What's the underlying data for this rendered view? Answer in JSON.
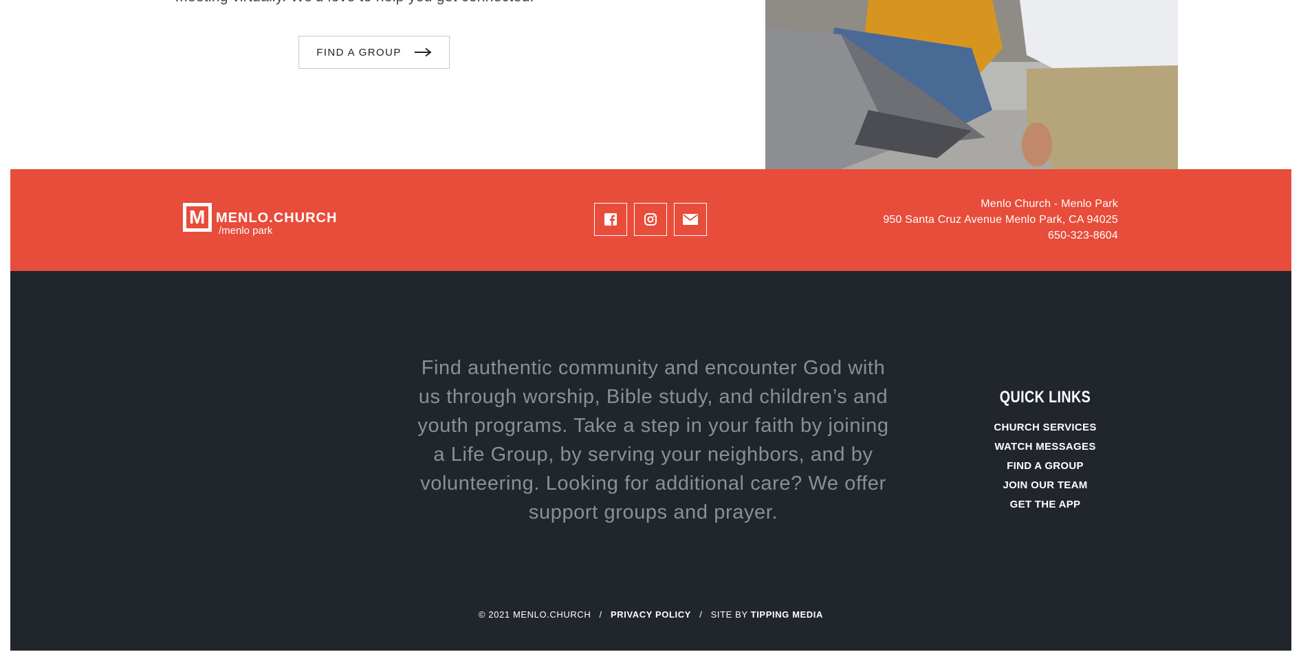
{
  "top": {
    "partial_text": "meeting virtually. We'd love to help you get connected.",
    "find_group_button": "FIND A GROUP"
  },
  "header_band": {
    "logo_mark": "M",
    "logo_title": "MENLO.CHURCH",
    "logo_subtitle": "/menlo park",
    "socials": [
      "facebook-icon",
      "instagram-icon",
      "mail-icon"
    ],
    "address_line1": "Menlo Church - Menlo Park",
    "address_line2": "950 Santa Cruz Avenue Menlo Park, CA 94025",
    "phone": "650-323-8604"
  },
  "footer": {
    "blurb": "Find authentic community and encounter God with us through worship, Bible study, and children’s and youth programs. Take a step in your faith by joining a Life Group, by serving your neighbors, and by volunteering. Looking for additional care? We offer support groups and prayer.",
    "quick_links_title": "QUICK LINKS",
    "quick_links": [
      "CHURCH SERVICES",
      "WATCH MESSAGES",
      "FIND A GROUP",
      "JOIN OUR TEAM",
      "GET THE APP"
    ],
    "copyright": "© 2021 MENLO.CHURCH",
    "sep": "/",
    "privacy": "PRIVACY POLICY",
    "site_by": "SITE BY",
    "agency": "TIPPING MEDIA"
  },
  "colors": {
    "brand_orange": "#e84c3a",
    "footer_dark": "#21262c"
  }
}
